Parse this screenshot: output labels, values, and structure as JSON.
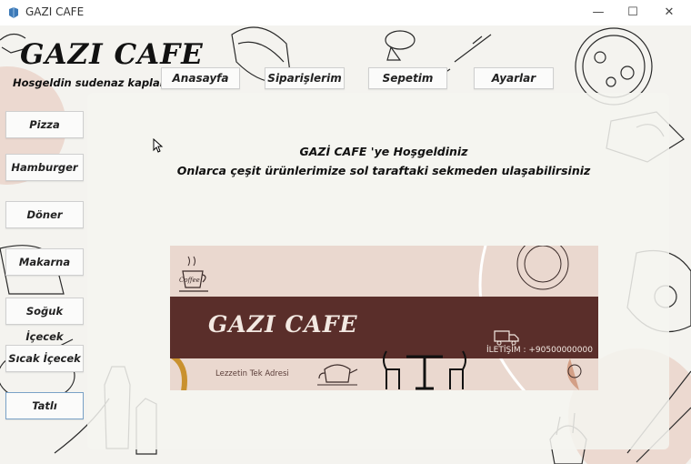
{
  "window": {
    "title": "GAZI CAFE",
    "controls": [
      "—",
      "☐",
      "✕"
    ]
  },
  "brand": {
    "name": "GAZI CAFE",
    "welcome": "Hosgeldin sudenaz kaplan"
  },
  "topnav": [
    "Anasayfa",
    "Siparişlerim",
    "Sepetim",
    "Ayarlar"
  ],
  "sidebar": [
    "Pizza",
    "Hamburger",
    "Döner",
    "Makarna",
    "Soğuk İçecek",
    "Sıcak İçecek",
    "Tatlı"
  ],
  "main": {
    "heading_line1": "GAZİ CAFE 'ye Hoşgeldiniz",
    "heading_line2": "Onlarca çeşit ürünlerimize sol taraftaki sekmeden ulaşabilirsiniz"
  },
  "banner": {
    "logo_text": "Coffee",
    "title": "GAZI CAFE",
    "tagline": "Lezzetin Tek Adresi",
    "contact": "İLETİŞİM : +90500000000"
  },
  "colors": {
    "banner_brown": "#5a2e2a",
    "banner_pink": "#ead8cf",
    "accent": "#d9a48a"
  }
}
